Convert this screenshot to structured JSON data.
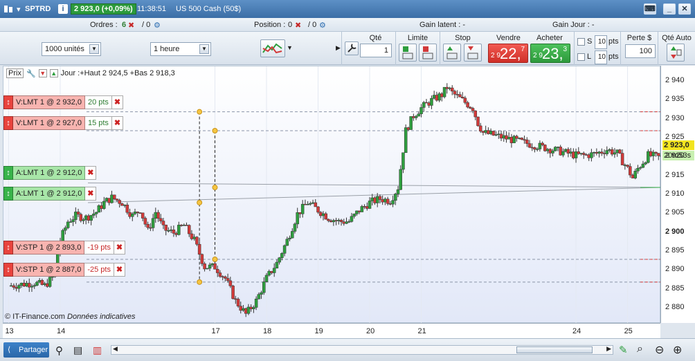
{
  "titlebar": {
    "instrument": "SPTRD",
    "info_icon": "i",
    "price": "2 923,0 (+0,09%)",
    "time": "11:38:51",
    "market": "US 500 Cash (50$)"
  },
  "status": {
    "orders_label": "Ordres :",
    "orders_count": "6",
    "orders_total": "/ 0",
    "position_label": "Position :",
    "position_count": "0",
    "position_total": "/ 0",
    "gain_latent": "Gain latent : -",
    "gain_jour": "Gain Jour : -"
  },
  "toolbar": {
    "units": "1000 unités",
    "period": "1 heure",
    "qty_label": "Qté",
    "qty_value": "1",
    "limit_label": "Limite",
    "stop_label": "Stop",
    "sell_label": "Vendre",
    "buy_label": "Acheter",
    "sell_small": "2 9",
    "sell_big": "22,",
    "sell_sup": "7",
    "buy_small": "2 9",
    "buy_big": "23,",
    "buy_sup": "3",
    "s_label": "S",
    "l_label": "L",
    "s_value": "10",
    "l_value": "10",
    "pts": "pts",
    "loss_label": "Perte $",
    "loss_value": "100",
    "auto_label": "Qté Auto"
  },
  "chart": {
    "prix": "Prix",
    "info": "Jour :+Haut 2 924,5 +Bas 2 918,3",
    "copyright": "© IT-Finance.com",
    "disclaimer": "Données indicatives",
    "current_price": "2 923,0",
    "countdown": "20m53s",
    "colors": {
      "up": "#2e9e3e",
      "down": "#d23a3a",
      "sell": "#e8433d",
      "buy": "#38b34a"
    }
  },
  "orders": [
    {
      "label": "V:LMT  1 @ 2 932,0",
      "pts": "20 pts",
      "price": 2932,
      "type": "sell",
      "anchor_day": 16.7
    },
    {
      "label": "V:LMT  1 @ 2 927,0",
      "pts": "15 pts",
      "price": 2927,
      "type": "sell",
      "anchor_day": 17.0
    },
    {
      "label": "A:LMT  1 @ 2 912,0",
      "pts": "",
      "price": 2912,
      "type": "buy",
      "anchor_day": 17.0
    },
    {
      "label": "A:LMT  1 @ 2 912,0",
      "pts": "",
      "price": 2912,
      "type": "buy",
      "anchor_day": 16.7
    },
    {
      "label": "V:STP  1 @ 2 893,0",
      "pts": "-19 pts",
      "price": 2893,
      "type": "sell",
      "anchor_day": 17.0
    },
    {
      "label": "V:STP  1 @ 2 887,0",
      "pts": "-25 pts",
      "price": 2887,
      "type": "sell",
      "anchor_day": 16.7
    }
  ],
  "bottombar": {
    "share": "Partager"
  },
  "chart_data": {
    "type": "candlestick",
    "yticks": [
      "2 940",
      "2 935",
      "2 930",
      "2 925",
      "2 920",
      "2 915",
      "2 910",
      "2 905",
      "2 900",
      "2 895",
      "2 890",
      "2 885",
      "2 880"
    ],
    "yvalues": [
      2940,
      2935,
      2930,
      2925,
      2920,
      2915,
      2910,
      2905,
      2900,
      2895,
      2890,
      2885,
      2880
    ],
    "bold_ytick": "2 900",
    "ylim": [
      2876,
      2944
    ],
    "xticks": [
      "13",
      "14",
      "17",
      "18",
      "19",
      "20",
      "21",
      "24",
      "25"
    ],
    "xdays": [
      13,
      14,
      17,
      18,
      19,
      20,
      21,
      24,
      25
    ],
    "xlim": [
      12.9,
      25.65
    ],
    "gridline_prices": [
      2932,
      2927,
      2893,
      2887
    ],
    "series": [
      {
        "name": "SPTRD",
        "points": [
          [
            13.0,
            2886.0
          ],
          [
            13.5,
            2886.8
          ],
          [
            13.7,
            2886.0
          ],
          [
            13.85,
            2888.2
          ],
          [
            14.0,
            2898.0
          ],
          [
            14.15,
            2903.0
          ],
          [
            14.3,
            2904.5
          ],
          [
            14.5,
            2904.0
          ],
          [
            14.7,
            2905.5
          ],
          [
            14.85,
            2908.0
          ],
          [
            15.0,
            2909.3
          ],
          [
            15.2,
            2908.0
          ],
          [
            15.4,
            2904.5
          ],
          [
            15.55,
            2906.2
          ],
          [
            15.7,
            2900.5
          ],
          [
            15.85,
            2905.5
          ],
          [
            16.0,
            2901.0
          ],
          [
            16.2,
            2900.0
          ],
          [
            16.4,
            2902.0
          ],
          [
            16.6,
            2898.0
          ],
          [
            16.8,
            2891.0
          ],
          [
            17.0,
            2891.0
          ],
          [
            17.2,
            2888.0
          ],
          [
            17.4,
            2882.0
          ],
          [
            17.6,
            2878.5
          ],
          [
            17.8,
            2882.0
          ],
          [
            18.0,
            2888.0
          ],
          [
            18.2,
            2892.0
          ],
          [
            18.4,
            2898.0
          ],
          [
            18.6,
            2905.0
          ],
          [
            18.8,
            2908.0
          ],
          [
            19.0,
            2906.0
          ],
          [
            19.2,
            2904.0
          ],
          [
            19.4,
            2903.0
          ],
          [
            19.6,
            2903.0
          ],
          [
            19.8,
            2906.0
          ],
          [
            20.0,
            2908.0
          ],
          [
            20.2,
            2909.0
          ],
          [
            20.4,
            2908.5
          ],
          [
            20.55,
            2912.0
          ],
          [
            20.7,
            2927.0
          ],
          [
            20.85,
            2931.0
          ],
          [
            21.0,
            2933.0
          ],
          [
            21.2,
            2935.0
          ],
          [
            21.4,
            2936.5
          ],
          [
            21.5,
            2938.5
          ],
          [
            21.6,
            2937.0
          ],
          [
            21.8,
            2935.0
          ],
          [
            22.0,
            2933.0
          ],
          [
            22.1,
            2929.0
          ],
          [
            22.2,
            2926.5
          ],
          [
            24.0,
            2920.5
          ],
          [
            24.2,
            2920.5
          ],
          [
            24.4,
            2921.0
          ],
          [
            24.6,
            2922.0
          ],
          [
            24.8,
            2921.0
          ],
          [
            25.0,
            2917.0
          ],
          [
            25.1,
            2914.5
          ],
          [
            25.2,
            2917.0
          ],
          [
            25.4,
            2920.5
          ],
          [
            25.6,
            2920.0
          ],
          [
            25.7,
            2920.0
          ],
          [
            25.85,
            2921.0
          ],
          [
            26.0,
            2923.0
          ]
        ]
      }
    ]
  }
}
